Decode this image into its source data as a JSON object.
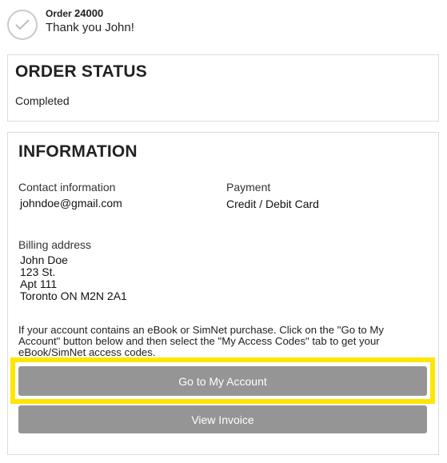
{
  "header": {
    "order_label": "Order",
    "order_number": "24000",
    "thank_you": "Thank you John!"
  },
  "order_status": {
    "title": "ORDER STATUS",
    "value": "Completed"
  },
  "information": {
    "title": "INFORMATION",
    "contact_label": "Contact information",
    "contact_value": "johndoe@gmail.com",
    "payment_label": "Payment",
    "payment_value": "Credit / Debit Card",
    "billing_label": "Billing address",
    "billing_lines": [
      "John Doe",
      "123 St.",
      "Apt 111",
      "Toronto ON M2N 2A1"
    ],
    "note_line1": "If your account contains an eBook or SimNet purchase. Click on the \"Go to My",
    "note_line2": "Account\" button below and then select the \"My Access Codes\" tab to get your",
    "note_line3": "eBook/SimNet access codes."
  },
  "buttons": {
    "go_to_account": "Go to My Account",
    "view_invoice": "View Invoice"
  },
  "colors": {
    "highlight": "#ffe600",
    "button_bg": "#959595",
    "button_text": "#ffffff"
  },
  "icons": {
    "status": "checkmark-circle-icon"
  }
}
